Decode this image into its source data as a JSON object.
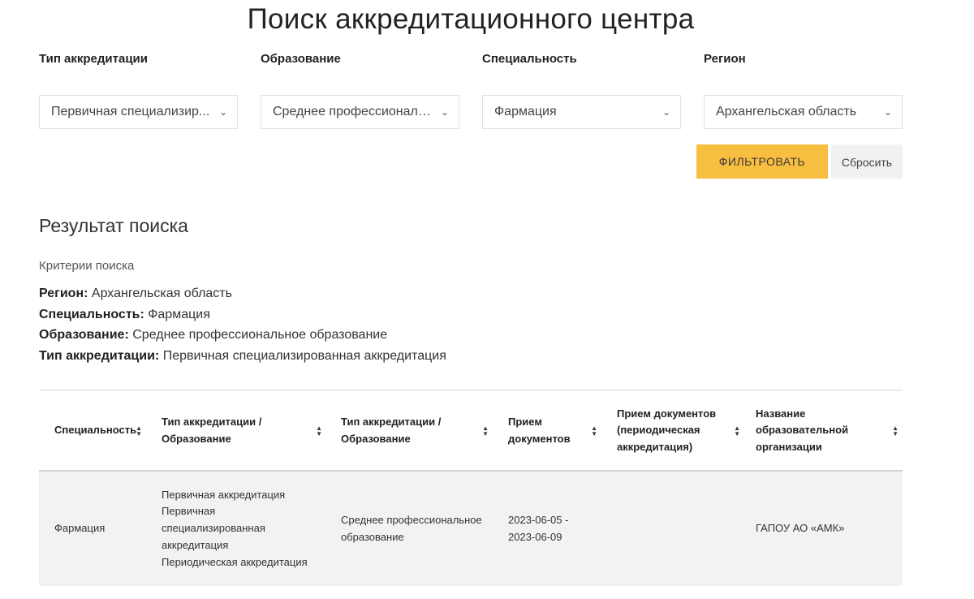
{
  "page": {
    "title": "Поиск аккредитационного центра"
  },
  "filters": [
    {
      "label": "Тип аккредитации",
      "value": "Первичная специализир..."
    },
    {
      "label": "Образование",
      "value": "Среднее профессиональ..."
    },
    {
      "label": "Специальность",
      "value": "Фармация"
    },
    {
      "label": "Регион",
      "value": "Архангельская область"
    }
  ],
  "buttons": {
    "filter": "ФИЛЬТРОВАТЬ",
    "reset": "Сбросить"
  },
  "results": {
    "title": "Результат поиска",
    "criteria_title": "Критерии поиска",
    "criteria": [
      {
        "label": "Регион:",
        "value": "Архангельская область"
      },
      {
        "label": "Специальность:",
        "value": "Фармация"
      },
      {
        "label": "Образование:",
        "value": "Среднее профессиональное образование"
      },
      {
        "label": "Тип аккредитации:",
        "value": "Первичная специализированная аккредитация"
      }
    ]
  },
  "table": {
    "headers": [
      [
        "Специальность"
      ],
      [
        "Тип аккредитации /",
        "Образование"
      ],
      [
        "Тип аккредитации /",
        "Образование"
      ],
      [
        "Прием",
        "документов"
      ],
      [
        "Прием документов",
        "(периодическая",
        "аккредитация)"
      ],
      [
        "Название",
        "образовательной",
        "организации"
      ]
    ],
    "sort_icon": "sort-arrows-icon",
    "rows": [
      {
        "specialty": "Фармация",
        "accreditation_types": [
          "Первичная аккредитация",
          "Первичная",
          "специализированная",
          "аккредитация",
          "Периодическая аккредитация"
        ],
        "education": [
          "Среднее профессиональное",
          "образование"
        ],
        "dates": [
          "2023-06-05 -",
          "2023-06-09"
        ],
        "periodic_dates": "",
        "organization": "ГАПОУ АО «АМК»"
      }
    ]
  },
  "colors": {
    "accent": "#f8be3f",
    "row_bg": "#f2f2f2",
    "reset_bg": "#f1f1f1"
  }
}
